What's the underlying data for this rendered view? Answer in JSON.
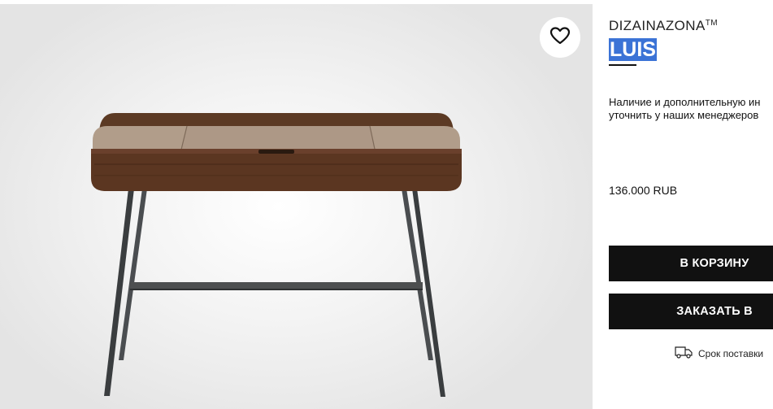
{
  "product": {
    "brand": "DIZAINAZONA",
    "brand_mark": "TM",
    "model": "LUIS",
    "availability_text": "Наличие и дополнительную ин",
    "availability_text_2": "уточнить у наших менеджеров",
    "price": "136.000 RUB"
  },
  "actions": {
    "cart_label": "В КОРЗИНУ",
    "order_label": "ЗАКАЗАТЬ В"
  },
  "delivery": {
    "text": "Срок поставки",
    "icon": "truck-icon"
  },
  "gallery": {
    "favorite_icon": "heart-icon"
  }
}
